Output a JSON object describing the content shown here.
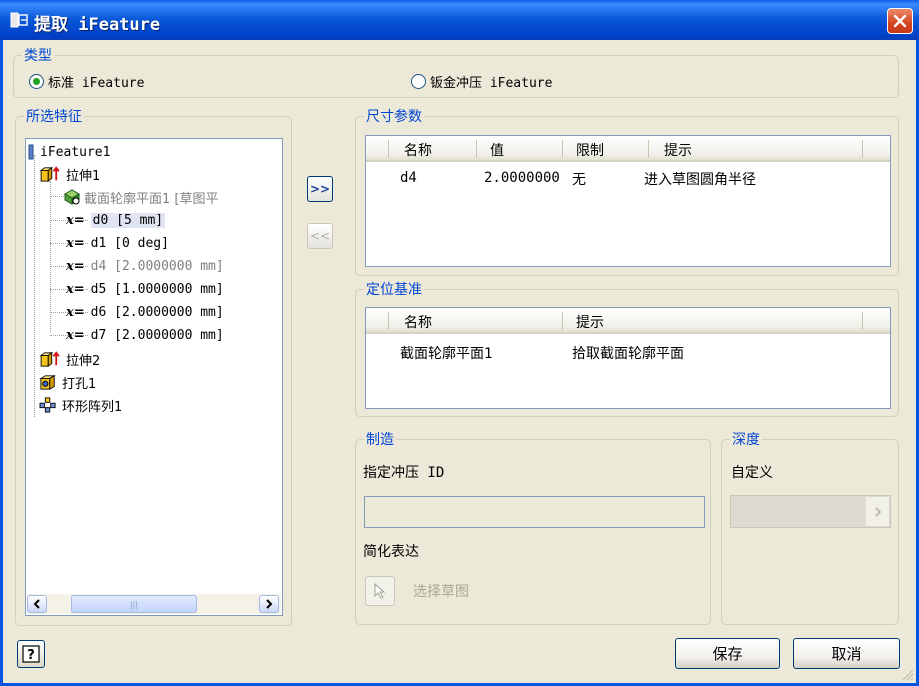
{
  "window": {
    "title": "提取 iFeature"
  },
  "type_group": {
    "legend": "类型",
    "option_standard": "标准 iFeature",
    "option_sheetmetal": "钣金冲压 iFeature",
    "selected": "standard"
  },
  "selected_features": {
    "legend": "所选特征",
    "tree": {
      "root": "iFeature1",
      "extrude1": "拉伸1",
      "sketch_plane": "截面轮廓平面1 [草图平",
      "x_prefix": "x=",
      "params": [
        {
          "name": "d0",
          "value": "[5 mm]",
          "selected": true,
          "dim": false
        },
        {
          "name": "d1",
          "value": "[0 deg]",
          "selected": false,
          "dim": false
        },
        {
          "name": "d4",
          "value": "[2.0000000 mm]",
          "selected": false,
          "dim": true
        },
        {
          "name": "d5",
          "value": "[1.0000000 mm]",
          "selected": false,
          "dim": false
        },
        {
          "name": "d6",
          "value": "[2.0000000 mm]",
          "selected": false,
          "dim": false
        },
        {
          "name": "d7",
          "value": "[2.0000000 mm]",
          "selected": false,
          "dim": false
        }
      ],
      "extrude2": "拉伸2",
      "hole1": "打孔1",
      "pattern1": "环形阵列1"
    }
  },
  "buttons": {
    "add": ">>",
    "remove": "<<",
    "save": "保存",
    "cancel": "取消",
    "help": "?"
  },
  "size_params": {
    "legend": "尺寸参数",
    "columns": [
      "名称",
      "值",
      "限制",
      "提示"
    ],
    "rows": [
      {
        "name": "d4",
        "value": "2.0000000",
        "limit": "无",
        "prompt": "进入草图圆角半径"
      }
    ]
  },
  "position_geometry": {
    "legend": "定位基准",
    "columns": [
      "名称",
      "提示"
    ],
    "rows": [
      {
        "name": "截面轮廓平面1",
        "prompt": "拾取截面轮廓平面"
      }
    ]
  },
  "manufacture": {
    "legend": "制造",
    "punch_id_label": "指定冲压 ID",
    "punch_id_value": "",
    "simplified_label": "简化表达",
    "select_sketch": "选择草图"
  },
  "depth": {
    "legend": "深度",
    "label": "自定义",
    "value": ""
  },
  "colors": {
    "titlebar": "#0055e5",
    "legend_text": "#0046d5",
    "dialog_bg": "#ece9d8"
  }
}
